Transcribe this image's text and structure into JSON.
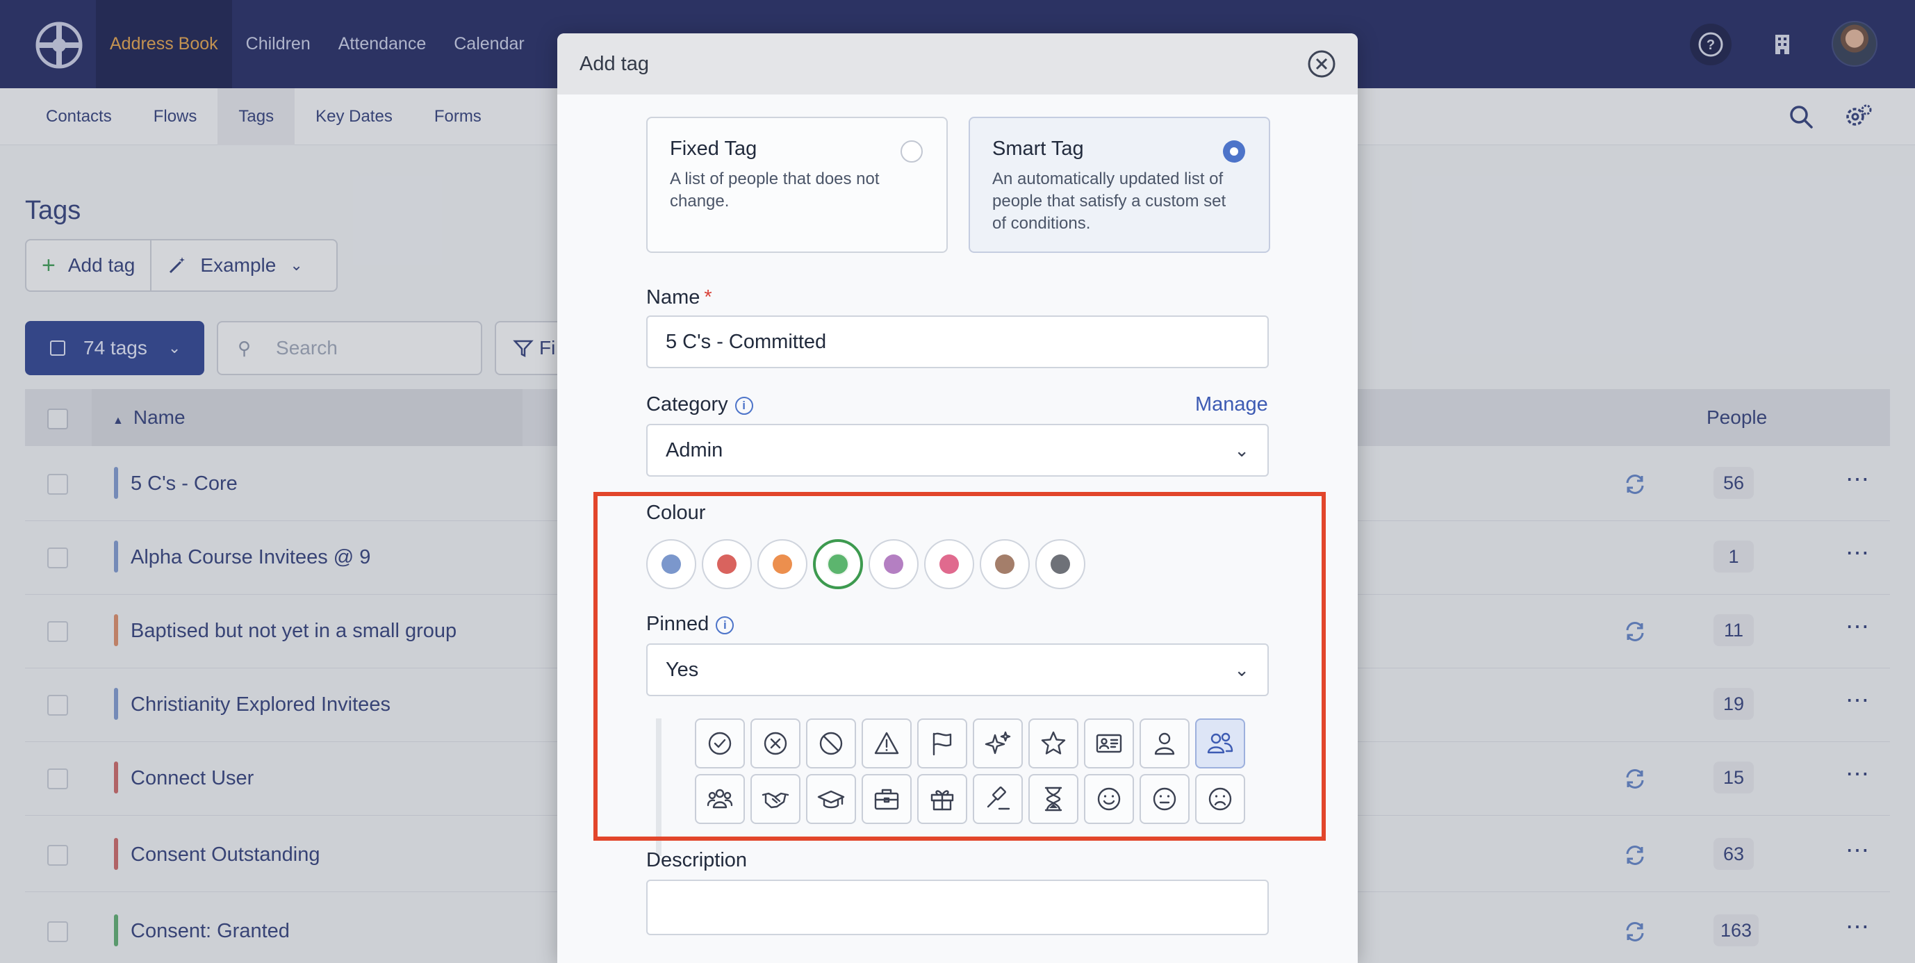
{
  "topbar": {
    "nav": [
      {
        "label": "Address Book",
        "active": true
      },
      {
        "label": "Children",
        "active": false
      },
      {
        "label": "Attendance",
        "active": false
      },
      {
        "label": "Calendar",
        "active": false
      }
    ],
    "icons": [
      "help-icon",
      "building-icon",
      "avatar"
    ]
  },
  "subnav": {
    "items": [
      {
        "label": "Contacts",
        "active": false
      },
      {
        "label": "Flows",
        "active": false
      },
      {
        "label": "Tags",
        "active": true
      },
      {
        "label": "Key Dates",
        "active": false
      },
      {
        "label": "Forms",
        "active": false
      }
    ]
  },
  "page": {
    "title": "Tags",
    "add_tag": "Add tag",
    "example": "Example",
    "tag_count": "74 tags",
    "search_placeholder": "Search",
    "filter": "Fi",
    "col_name": "Name",
    "col_people": "People"
  },
  "rows": [
    {
      "name": "5 C's - Core",
      "color": "#7b97cc",
      "smart": true,
      "count": "56"
    },
    {
      "name": "Alpha Course Invitees @ 9",
      "color": "#7b97cc",
      "smart": false,
      "count": "1"
    },
    {
      "name": "Baptised but not yet in a small group",
      "color": "#d98a66",
      "smart": true,
      "count": "11"
    },
    {
      "name": "Christianity Explored Invitees",
      "color": "#7b97cc",
      "smart": false,
      "count": "19"
    },
    {
      "name": "Connect User",
      "color": "#c86464",
      "smart": true,
      "count": "15"
    },
    {
      "name": "Consent Outstanding",
      "color": "#c86464",
      "smart": true,
      "count": "63"
    },
    {
      "name": "Consent: Granted",
      "color": "#5aaa6e",
      "smart": true,
      "count": "163"
    }
  ],
  "modal": {
    "title": "Add tag",
    "fixed": {
      "title": "Fixed Tag",
      "desc": "A list of people that does not change."
    },
    "smart": {
      "title": "Smart Tag",
      "desc": "An automatically updated list of people that satisfy a custom set of conditions."
    },
    "selected_type": "smart",
    "name_label": "Name",
    "name_value": "5 C's - Committed",
    "category_label": "Category",
    "manage": "Manage",
    "category_value": "Admin",
    "colour_label": "Colour",
    "colours": [
      "#7b97cc",
      "#d9635e",
      "#ec8f4e",
      "#5cb56e",
      "#b47fc2",
      "#e06a8e",
      "#a47e6a",
      "#6e7178"
    ],
    "selected_colour_index": 3,
    "pinned_label": "Pinned",
    "pinned_value": "Yes",
    "icons": [
      "check-circle-icon",
      "x-circle-icon",
      "ban-icon",
      "warning-icon",
      "flag-icon",
      "sparkles-icon",
      "star-icon",
      "id-card-icon",
      "person-icon",
      "people-icon",
      "group-icon",
      "handshake-icon",
      "graduation-cap-icon",
      "briefcase-icon",
      "gift-icon",
      "gavel-icon",
      "hourglass-icon",
      "smile-icon",
      "neutral-face-icon",
      "frown-icon"
    ],
    "selected_icon_index": 9,
    "description_label": "Description"
  }
}
